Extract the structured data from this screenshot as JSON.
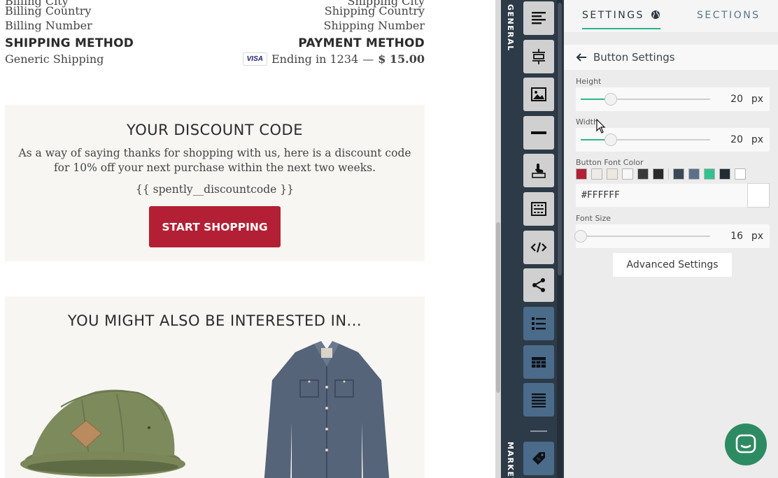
{
  "email": {
    "billing_country": "Billing Country",
    "shipping_country": "Shipping Country",
    "billing_number": "Billing Number",
    "shipping_number": "Shipping Number",
    "shipping_method_heading": "SHIPPING METHOD",
    "shipping_method_value": "Generic Shipping",
    "payment_method_heading": "PAYMENT METHOD",
    "card_brand": "VISA",
    "card_ending": "Ending in 1234",
    "payment_separator": "—",
    "payment_amount": "$ 15.00",
    "discount_title": "YOUR DISCOUNT CODE",
    "discount_body": "As a way of saying thanks for shopping with us, here is a discount code for 10% off your next purchase within the next two weeks.",
    "discount_code": "{{ spently__discountcode }}",
    "cta_label": "START SHOPPING",
    "cta_color": "#b31f34",
    "interest_title": "YOU MIGHT ALSO BE INTERESTED IN..."
  },
  "toolbar": {
    "general_label": "GENERAL",
    "marketing_label": "MARKET",
    "tools": [
      "align-text-icon",
      "spacer-icon",
      "image-icon",
      "divider-icon",
      "button-pointer-icon",
      "image-grid-icon",
      "code-icon",
      "share-icon",
      "list-icon",
      "table-icon",
      "lines-icon",
      "tag-icon"
    ]
  },
  "panel": {
    "tab_settings": "SETTINGS",
    "tab_sections": "SECTIONS",
    "header_title": "Button Settings",
    "height_label": "Height",
    "height_value": "20",
    "height_level": 0.23,
    "width_label": "Width",
    "width_value": "20",
    "width_level": 0.23,
    "unit": "px",
    "font_color_label": "Button Font Color",
    "swatches": [
      "#b31f34",
      "#efebe4",
      "#ebe8e0",
      "#f7f7f7",
      "#3a3a3a",
      "#2a2a2a",
      "#3a4756",
      "#5b7189",
      "#33c28f",
      "#232b33",
      "#ffffff"
    ],
    "color_value": "#FFFFFF",
    "font_size_label": "Font Size",
    "font_size_value": "16",
    "font_size_level": 0.0,
    "advanced_label": "Advanced Settings",
    "accent_color": "#29b38c"
  }
}
